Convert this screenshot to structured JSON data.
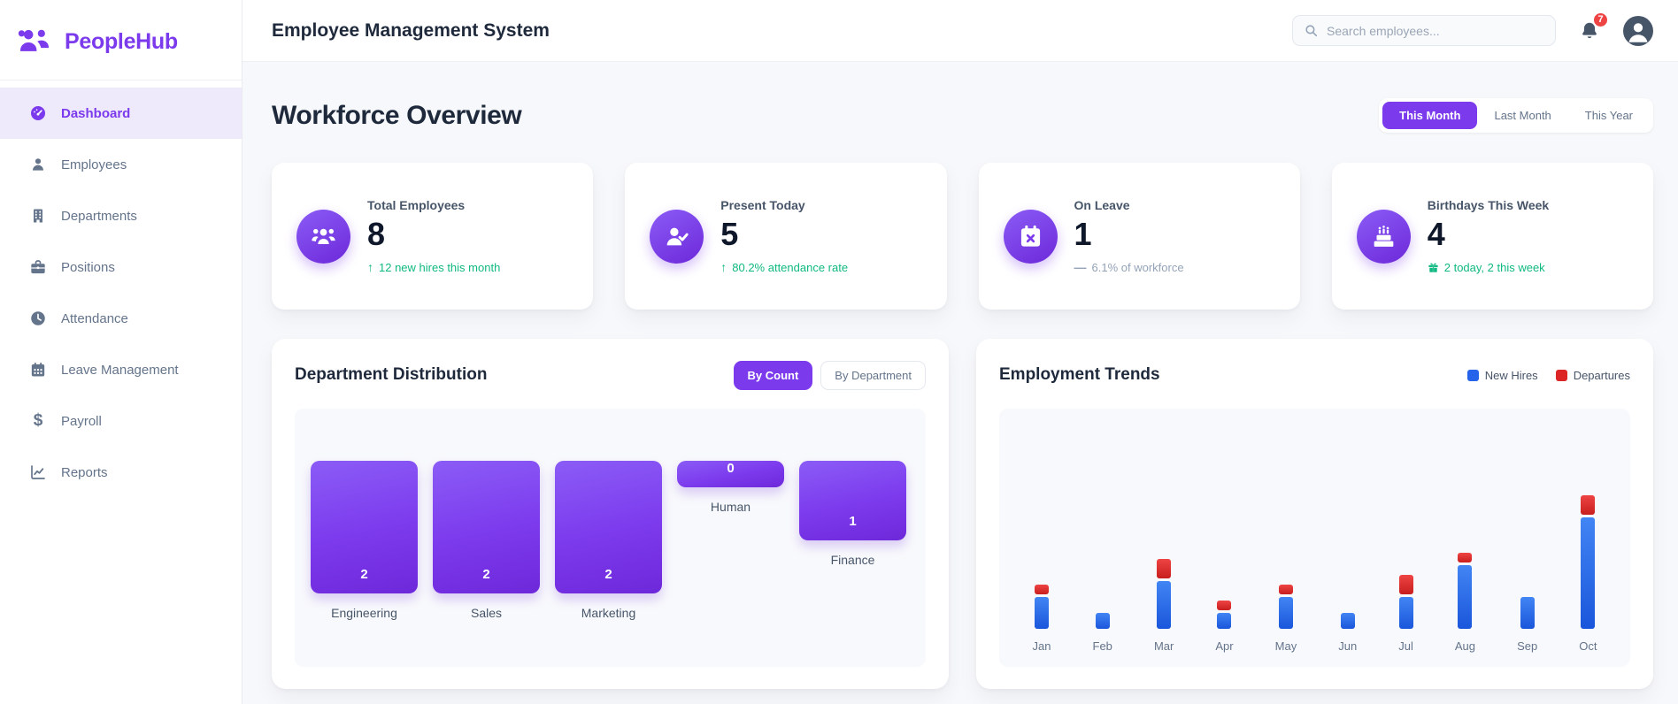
{
  "brand": {
    "name": "PeopleHub"
  },
  "sidebar": {
    "items": [
      {
        "label": "Dashboard",
        "active": true
      },
      {
        "label": "Employees",
        "active": false
      },
      {
        "label": "Departments",
        "active": false
      },
      {
        "label": "Positions",
        "active": false
      },
      {
        "label": "Attendance",
        "active": false
      },
      {
        "label": "Leave Management",
        "active": false
      },
      {
        "label": "Payroll",
        "active": false
      },
      {
        "label": "Reports",
        "active": false
      }
    ]
  },
  "header": {
    "title": "Employee Management System",
    "search_placeholder": "Search employees...",
    "notification_count": "7"
  },
  "overview": {
    "title": "Workforce Overview",
    "period_tabs": [
      {
        "label": "This Month",
        "active": true
      },
      {
        "label": "Last Month",
        "active": false
      },
      {
        "label": "This Year",
        "active": false
      }
    ]
  },
  "stats": [
    {
      "label": "Total Employees",
      "value": "8",
      "trend": "up",
      "trend_glyph": "↑",
      "sub": "12 new hires this month",
      "icon": "users-icon"
    },
    {
      "label": "Present Today",
      "value": "5",
      "trend": "up",
      "trend_glyph": "↑",
      "sub": "80.2% attendance rate",
      "icon": "user-check-icon"
    },
    {
      "label": "On Leave",
      "value": "1",
      "trend": "neutral",
      "trend_glyph": "—",
      "sub": "6.1% of workforce",
      "icon": "calendar-x-icon"
    },
    {
      "label": "Birthdays This Week",
      "value": "4",
      "trend": "gift",
      "trend_glyph": "",
      "sub": "2 today, 2 this week",
      "icon": "cake-icon"
    }
  ],
  "panels": {
    "departments": {
      "title": "Department Distribution",
      "toggles": [
        {
          "label": "By Count",
          "active": true
        },
        {
          "label": "By Department",
          "active": false
        }
      ]
    },
    "trends": {
      "title": "Employment Trends",
      "legend": [
        {
          "label": "New Hires",
          "color": "#2563eb"
        },
        {
          "label": "Departures",
          "color": "#dc2626"
        }
      ]
    }
  },
  "chart_data": [
    {
      "type": "bar",
      "title": "Department Distribution",
      "categories": [
        "Engineering",
        "Sales",
        "Marketing",
        "Human",
        "Finance"
      ],
      "values": [
        2,
        2,
        2,
        0,
        1
      ],
      "value_labels_shown": true,
      "orientation": "top-aligned-hanging-bars",
      "bar_color": "#7c3aed",
      "grid": false
    },
    {
      "type": "bar",
      "stacked": true,
      "title": "Employment Trends",
      "categories": [
        "Jan",
        "Feb",
        "Mar",
        "Apr",
        "May",
        "Jun",
        "Jul",
        "Aug",
        "Sep",
        "Oct"
      ],
      "series": [
        {
          "name": "New Hires",
          "color": "#2563eb",
          "values": [
            2,
            1,
            3,
            1,
            2,
            1,
            2,
            4,
            2,
            7
          ]
        },
        {
          "name": "Departures",
          "color": "#dc2626",
          "values": [
            1,
            0,
            2,
            1,
            1,
            0,
            2,
            1,
            0,
            2
          ]
        }
      ],
      "legend_position": "top-right",
      "axis_labels_shown": false,
      "grid": false
    }
  ],
  "colors": {
    "primary": "#7c3aed",
    "positive": "#10b981",
    "neutral_text": "#94a3b8",
    "new_hires": "#2563eb",
    "departures": "#dc2626",
    "badge": "#ef4444"
  }
}
